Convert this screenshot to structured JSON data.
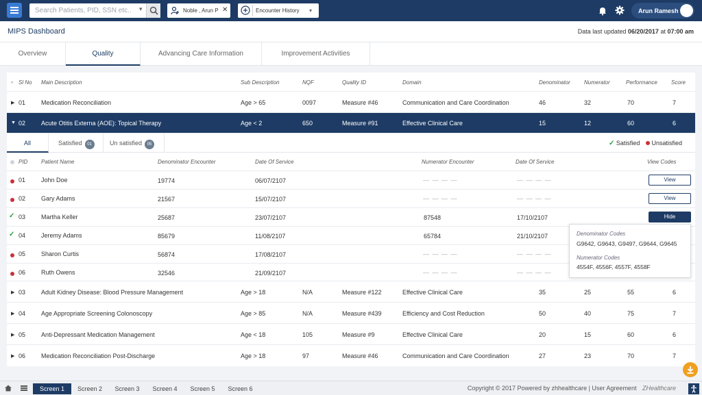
{
  "search": {
    "placeholder": "Search Patients, PID, SSN etc.."
  },
  "chips": {
    "patient": "Noble , Arun P",
    "history": "Encounter History"
  },
  "user": {
    "name": "Arun Ramesh"
  },
  "page": {
    "title": "MIPS Dashboard",
    "updated_prefix": "Data last updated",
    "updated_date": "06/20/2017",
    "updated_at": "at",
    "updated_time": "07:00 am"
  },
  "tabs": [
    "Overview",
    "Quality",
    "Advancing Care Information",
    "Improvement Activities"
  ],
  "table": {
    "headers": {
      "sl": "Sl No",
      "main": "Main Description",
      "sub": "Sub Description",
      "nqf": "NQF",
      "qid": "Quality ID",
      "domain": "Domain",
      "den": "Denominator",
      "num": "Numerator",
      "perf": "Performance",
      "score": "Score"
    },
    "rows": [
      {
        "sl": "01",
        "main": "Medication Reconciliation",
        "sub": "Age > 65",
        "nqf": "0097",
        "qid": "Measure #46",
        "domain": "Communication and Care Coordination",
        "den": "46",
        "num": "32",
        "perf": "70",
        "score": "7"
      },
      {
        "sl": "02",
        "main": "Acute Otitis Externa (AOE): Topical Therapy",
        "sub": "Age < 2",
        "nqf": "650",
        "qid": "Measure #91",
        "domain": "Effective Clinical Care",
        "den": "15",
        "num": "12",
        "perf": "60",
        "score": "6"
      },
      {
        "sl": "03",
        "main": "Adult Kidney Disease: Blood Pressure Management",
        "sub": "Age > 18",
        "nqf": "N/A",
        "qid": "Measure #122",
        "domain": "Effective Clinical Care",
        "den": "35",
        "num": "25",
        "perf": "55",
        "score": "6"
      },
      {
        "sl": "04",
        "main": "Age Appropriate Screening Colonoscopy",
        "sub": "Age > 85",
        "nqf": "N/A",
        "qid": "Measure #439",
        "domain": "Efficiency and Cost Reduction",
        "den": "50",
        "num": "40",
        "perf": "75",
        "score": "7"
      },
      {
        "sl": "05",
        "main": "Anti-Depressant Medication Management",
        "sub": "Age < 18",
        "nqf": "105",
        "qid": "Measure #9",
        "domain": "Effective Clinical Care",
        "den": "20",
        "num": "15",
        "perf": "60",
        "score": "6"
      },
      {
        "sl": "06",
        "main": "Medication Reconciliation Post-Discharge",
        "sub": "Age > 18",
        "nqf": "97",
        "qid": "Measure #46",
        "domain": "Communication and Care Coordination",
        "den": "27",
        "num": "23",
        "perf": "70",
        "score": "7"
      }
    ]
  },
  "subtabs": {
    "all": "All",
    "satisfied": "Satisfied",
    "satisfied_count": "01",
    "unsatisfied": "Un satisfied",
    "unsatisfied_count": "05"
  },
  "legend": {
    "satisfied": "Satisfied",
    "unsatisfied": "Unsatisfied"
  },
  "patients": {
    "headers": {
      "pid": "PID",
      "name": "Patient Name",
      "den_enc": "Denominator Encounter",
      "dos1": "Date Of Service",
      "num_enc": "Numerator Encounter",
      "dos2": "Date Of Service",
      "codes": "View Codes"
    },
    "rows": [
      {
        "pid": "01",
        "name": "John Doe",
        "den_enc": "19774",
        "dos1": "06/07/2107",
        "num_enc": "— — — —",
        "dos2": "— — — —",
        "status": "unsatisfied",
        "action": "View"
      },
      {
        "pid": "02",
        "name": "Gary Adams",
        "den_enc": "21567",
        "dos1": "15/07/2107",
        "num_enc": "— — — —",
        "dos2": "— — — —",
        "status": "unsatisfied",
        "action": "View"
      },
      {
        "pid": "03",
        "name": "Martha Keller",
        "den_enc": "25687",
        "dos1": "23/07/2107",
        "num_enc": "87548",
        "dos2": "17/10/2107",
        "status": "satisfied",
        "action": "Hide"
      },
      {
        "pid": "04",
        "name": "Jeremy Adams",
        "den_enc": "85679",
        "dos1": "11/08/2107",
        "num_enc": "65784",
        "dos2": "21/10/2107",
        "status": "satisfied",
        "action": ""
      },
      {
        "pid": "05",
        "name": "Sharon Curtis",
        "den_enc": "56874",
        "dos1": "17/08/2107",
        "num_enc": "— — — —",
        "dos2": "— — — —",
        "status": "unsatisfied",
        "action": ""
      },
      {
        "pid": "06",
        "name": "Ruth Owens",
        "den_enc": "32546",
        "dos1": "21/09/2107",
        "num_enc": "— — — —",
        "dos2": "— — — —",
        "status": "unsatisfied",
        "action": ""
      }
    ]
  },
  "popup": {
    "den_title": "Denominator Codes",
    "den_codes": "G9642,  G9643,  G9497,  G9644,  G9645",
    "num_title": "Numerator Codes",
    "num_codes": "4554F,  4556F, 4557F, 4558F"
  },
  "footer": {
    "tabs": [
      "Screen 1",
      "Screen 2",
      "Screen 3",
      "Screen 4",
      "Screen 5",
      "Screen 6"
    ],
    "copyright": "Copyright © 2017 Powered by zhhealthcare | User Agreement",
    "brand": "ZHealthcare"
  },
  "colors": {
    "navy": "#1d3b64",
    "unsatisfied": "#c8323a",
    "satisfied": "#2d9a3e",
    "fab": "#f0a020"
  }
}
